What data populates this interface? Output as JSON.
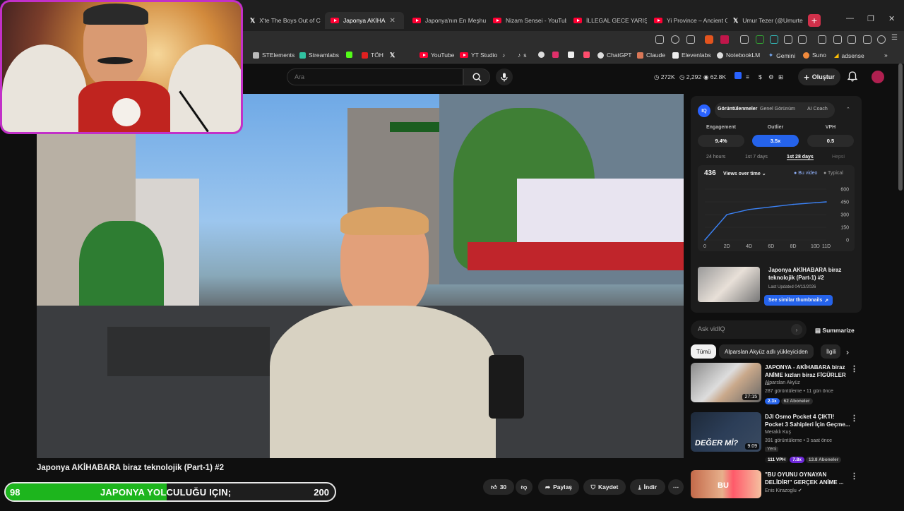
{
  "tabs": [
    {
      "label": "X'te The Boys Out of C",
      "icon": "x-icon"
    },
    {
      "label": "Japonya AKİHA",
      "icon": "youtube-icon",
      "active": true
    },
    {
      "label": "Japonya'nın En Meşhur",
      "icon": "youtube-icon"
    },
    {
      "label": "Nizam Sensei - YouTub",
      "icon": "youtube-icon"
    },
    {
      "label": "İLLEGAL GECE YARIŞIN",
      "icon": "youtube-icon"
    },
    {
      "label": "Yi Province – Ancient C",
      "icon": "youtube-icon"
    },
    {
      "label": "Umur Tezer (@Umurte",
      "icon": "x-icon"
    }
  ],
  "bookmarks": [
    "STElements",
    "Streamlabs",
    "TÖH",
    "YouTube",
    "YT Studio",
    "s",
    "ChatGPT",
    "Claude",
    "Elevenlabs",
    "NotebookLM",
    "Gemini",
    "Suno",
    "adsense"
  ],
  "header": {
    "search_placeholder": "Ara",
    "stats": [
      "272K",
      "2,292",
      "62.8K"
    ],
    "create_label": "Oluştur"
  },
  "video": {
    "title": "Japonya AKİHABARA biraz teknolojik (Part-1) #2",
    "channel": "Alparslan Akyüz",
    "likes": "30",
    "share_label": "Paylaş",
    "save_label": "Kaydet",
    "download_label": "İndir"
  },
  "vidiq": {
    "tabs": [
      "Görüntülenmeler",
      "Genel Görünüm",
      "AI Coach"
    ],
    "metrics": [
      {
        "label": "Engagement",
        "value": "9.4%"
      },
      {
        "label": "Outlier",
        "value": "3.5x"
      },
      {
        "label": "VPH",
        "value": "0.5"
      }
    ],
    "ranges": [
      "24 hours",
      "1st 7 days",
      "1st 28 days",
      "Hepsi"
    ],
    "views": "436",
    "views_mode": "Views over time",
    "legend": [
      "Bu video",
      "Typical"
    ],
    "similar_title": "Japonya AKİHABARA biraz teknolojik (Part-1) #2",
    "last_updated": "Last Updated 04/13/2026",
    "similar_btn": "See similar thumbnails",
    "ask_placeholder": "Ask vidIQ",
    "summarize_label": "Summarize"
  },
  "chart_data": {
    "type": "line",
    "x": [
      0,
      2,
      4,
      6,
      8,
      10,
      11
    ],
    "series": [
      {
        "name": "Bu video",
        "values": [
          0,
          300,
          360,
          390,
          420,
          440,
          450
        ]
      }
    ],
    "xticks": [
      "0",
      "2D",
      "4D",
      "6D",
      "8D",
      "10D",
      "11D"
    ],
    "yticks": [
      "0",
      "150",
      "300",
      "450",
      "600"
    ],
    "ylim": [
      0,
      600
    ],
    "color": "#3b82f6"
  },
  "chips": [
    "Tümü",
    "Alparslan Akyüz adlı yükleyiciden",
    "İlgili"
  ],
  "recommendations": [
    {
      "title": "JAPONYA - AKİHABARA biraz ANİME kızları biraz FİGÜRLER ...",
      "channel": "Alparslan Akyüz",
      "meta": "287 görüntüleme • 11 gün önce",
      "duration": "27:15",
      "badge1": "2.3x",
      "badge2": "62 Aboneler"
    },
    {
      "title": "DJI Osmo Pocket 4 ÇIKTI! Pocket 3 Sahipleri İçin Geçme...",
      "channel": "Meraklı Kuş",
      "meta": "391 görüntüleme • 3 saat önce",
      "duration": "9:09",
      "extra": "Yeni",
      "thumb_text": "DEĞER Mİ?",
      "badge1": "111 VPH",
      "badge2": "7.8x",
      "badge3": "13.8 Aboneler"
    },
    {
      "title": "\"BU OYUNU OYNAYAN DELİDİR!\" GERÇEK ANİME ...",
      "channel": "Enis Kirazoglu",
      "meta": "",
      "duration": "",
      "thumb_text": "BU"
    }
  ],
  "goal": {
    "current": "98",
    "target": "200",
    "label": "JAPONYA YOLCULUĞU IÇIN;",
    "progress": 0.49
  }
}
